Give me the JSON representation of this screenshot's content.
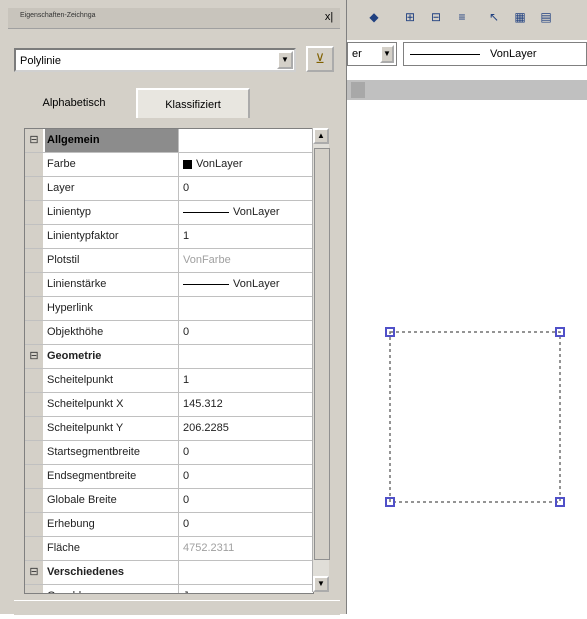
{
  "panel": {
    "title": "Eigenschaften-Zeichnga",
    "close_label": "x|",
    "object_selector": "Polylinie",
    "tabs": [
      {
        "label": "Alphabetisch"
      },
      {
        "label": "Klassifiziert"
      }
    ]
  },
  "rows": [
    {
      "expander": "⊟",
      "name": "Allgemein",
      "value": ""
    },
    {
      "name": "Farbe",
      "value": "VonLayer"
    },
    {
      "name": "Layer",
      "value": "0"
    },
    {
      "name": "Linientyp",
      "value": "VonLayer"
    },
    {
      "name": "Linientypfaktor",
      "value": "1"
    },
    {
      "name": "Plotstil",
      "value": "VonFarbe"
    },
    {
      "name": "Linienstärke",
      "value": "VonLayer"
    },
    {
      "name": "Hyperlink",
      "value": ""
    },
    {
      "name": "Objekthöhe",
      "value": "0"
    },
    {
      "expander": "⊟",
      "name": "Geometrie",
      "value": ""
    },
    {
      "name": "Scheitelpunkt",
      "value": "1"
    },
    {
      "name": "Scheitelpunkt X",
      "value": "145.312"
    },
    {
      "name": "Scheitelpunkt Y",
      "value": "206.2285"
    },
    {
      "name": "Startsegmentbreite",
      "value": "0"
    },
    {
      "name": "Endsegmentbreite",
      "value": "0"
    },
    {
      "name": "Globale Breite",
      "value": "0"
    },
    {
      "name": "Erhebung",
      "value": "0"
    },
    {
      "name": "Fläche",
      "value": "4752.2311"
    },
    {
      "expander": "⊟",
      "name": "Verschiedenes",
      "value": ""
    },
    {
      "name": "Geschlossen",
      "value": "Ja"
    }
  ],
  "toolbar": {
    "layer_value": "er",
    "linetype_value": "VonLayer"
  },
  "colors": {
    "grip": "#5050c8",
    "panel_bg": "#d4d0c8"
  }
}
